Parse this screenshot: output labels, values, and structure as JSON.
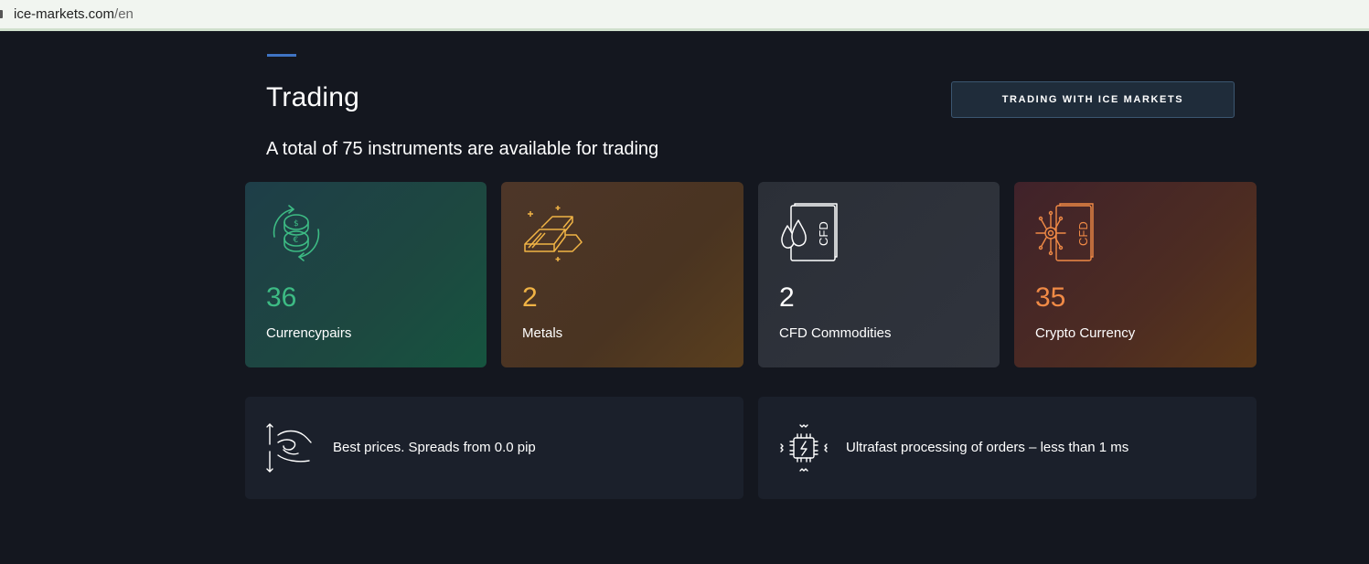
{
  "browser": {
    "url_host": "ice-markets.com",
    "url_path": "/en"
  },
  "section": {
    "title": "Trading",
    "subtitle": "A total of 75 instruments are available for trading",
    "cta_label": "TRADING WITH ICE MARKETS"
  },
  "cards": [
    {
      "count": "36",
      "label": "Currencypairs",
      "icon": "currency-exchange-icon",
      "color": "#3dbb84"
    },
    {
      "count": "2",
      "label": "Metals",
      "icon": "gold-bars-icon",
      "color": "#f0b345"
    },
    {
      "count": "2",
      "label": "CFD Commodities",
      "icon": "cfd-commodities-icon",
      "color": "#ffffff",
      "icon_text": "CFD"
    },
    {
      "count": "35",
      "label": "Crypto Currency",
      "icon": "cfd-crypto-icon",
      "color": "#f08a46",
      "icon_text": "CFD"
    }
  ],
  "features": [
    {
      "text": "Best prices. Spreads from 0.0 pip",
      "icon": "hand-spread-icon"
    },
    {
      "text": "Ultrafast processing of orders – less than 1 ms",
      "icon": "processor-icon"
    }
  ]
}
